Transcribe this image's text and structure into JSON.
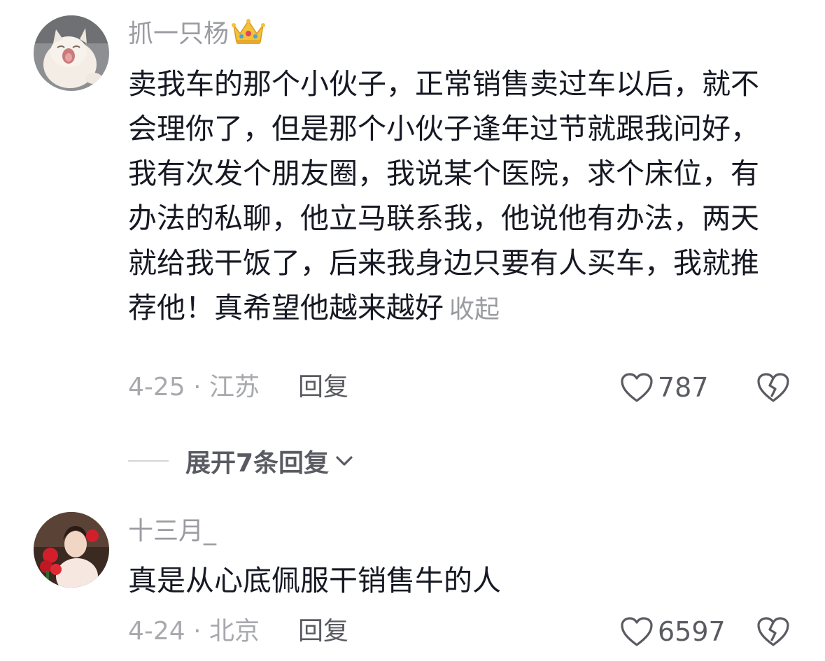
{
  "comments": [
    {
      "username": "抓一只杨",
      "badge_icon": "crown-icon",
      "text": "卖我车的那个小伙子，正常销售卖过车以后，就不会理你了，但是那个小伙子逢年过节就跟我问好，我有次发个朋友圈，我说某个医院，求个床位，有办法的私聊，他立马联系我，他说他有办法，两天就给我干饭了，后来我身边只要有人买车，我就推荐他！真希望他越来越好",
      "collapse_label": "收起",
      "meta": "4-25 · 江苏",
      "reply_label": "回复",
      "likes": "787"
    },
    {
      "username": "十三月_",
      "text": "真是从心底佩服干销售牛的人",
      "meta": "4-24 · 北京",
      "reply_label": "回复",
      "likes": "6597"
    }
  ],
  "expand_replies": "展开7条回复",
  "colors": {
    "text": "#161823",
    "muted": "#9b9ca1",
    "action": "#5a5b62"
  }
}
